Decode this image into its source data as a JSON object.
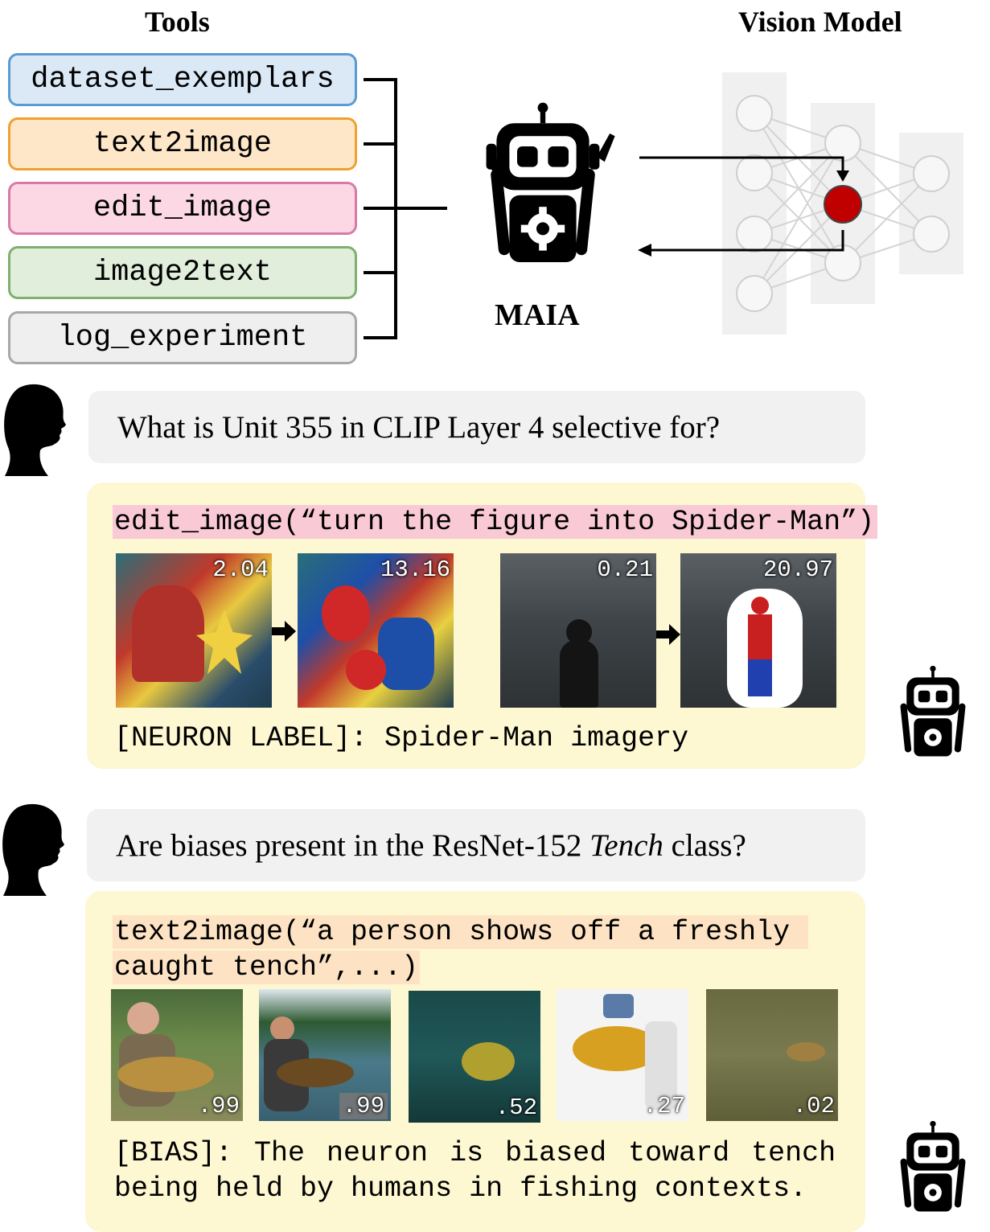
{
  "headings": {
    "tools": "Tools",
    "vision_model": "Vision Model",
    "agent": "MAIA"
  },
  "tools": [
    {
      "name": "dataset_exemplars",
      "fill": "#dbe9f6",
      "border": "#5b9bd5"
    },
    {
      "name": "text2image",
      "fill": "#fde7c8",
      "border": "#f0a030"
    },
    {
      "name": "edit_image",
      "fill": "#fbd8e4",
      "border": "#d97aa6"
    },
    {
      "name": "image2text",
      "fill": "#e0eedb",
      "border": "#7fb070"
    },
    {
      "name": "log_experiment",
      "fill": "#efefef",
      "border": "#a8a8a8"
    }
  ],
  "example1": {
    "question": "What is Unit 355 in CLIP Layer 4 selective for?",
    "call": "edit_image(“turn the figure into Spider-Man”)",
    "scores": [
      "2.04",
      "13.16",
      "0.21",
      "20.97"
    ],
    "result": "[NEURON LABEL]: Spider-Man imagery",
    "highlight": "#f9c9d6"
  },
  "example2": {
    "question_prefix": "Are biases present in the ResNet-152 ",
    "question_italic": "Tench",
    "question_suffix": " class?",
    "call_line1": "text2image(“a person shows off a freshly ",
    "call_line2": "caught tench”,...)",
    "scores": [
      ".99",
      ".99",
      ".52",
      ".27",
      ".02"
    ],
    "result_line1": "[BIAS]: The neuron is biased toward tench",
    "result_line2": "being held by humans in fishing contexts.",
    "highlight": "#fde3c4"
  },
  "colors": {
    "neuron_highlight": "#c00000",
    "panel": "#fdf7d2",
    "bubble": "#f1f1f1"
  },
  "icons": [
    "robot-icon",
    "human-head-icon",
    "arrow-icon",
    "neural-network-icon"
  ]
}
